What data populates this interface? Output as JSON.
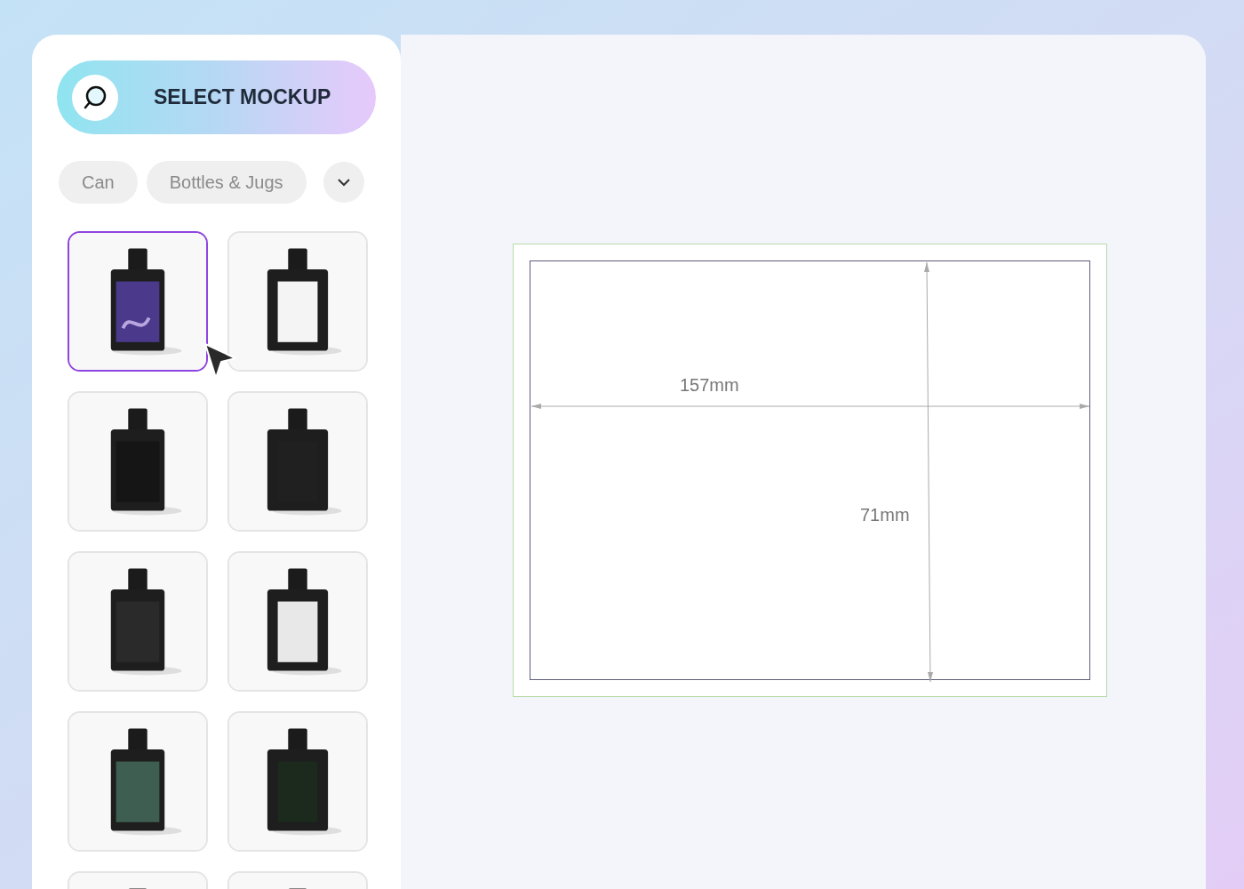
{
  "search_button": {
    "label": "SELECT MOCKUP"
  },
  "categories": [
    {
      "label": "Can"
    },
    {
      "label": "Bottles & Jugs"
    }
  ],
  "mockups": [
    {
      "kind": "picture",
      "selected": true
    },
    {
      "kind": "picture",
      "selected": false
    },
    {
      "kind": "picture",
      "selected": false
    },
    {
      "kind": "picture",
      "selected": false
    },
    {
      "kind": "picture",
      "selected": false
    },
    {
      "kind": "picture",
      "selected": false
    },
    {
      "kind": "picture",
      "selected": false
    },
    {
      "kind": "picture",
      "selected": false
    },
    {
      "kind": "picture",
      "selected": false
    },
    {
      "kind": "picture",
      "selected": false
    }
  ],
  "canvas": {
    "width_label": "157mm",
    "height_label": "71mm"
  }
}
